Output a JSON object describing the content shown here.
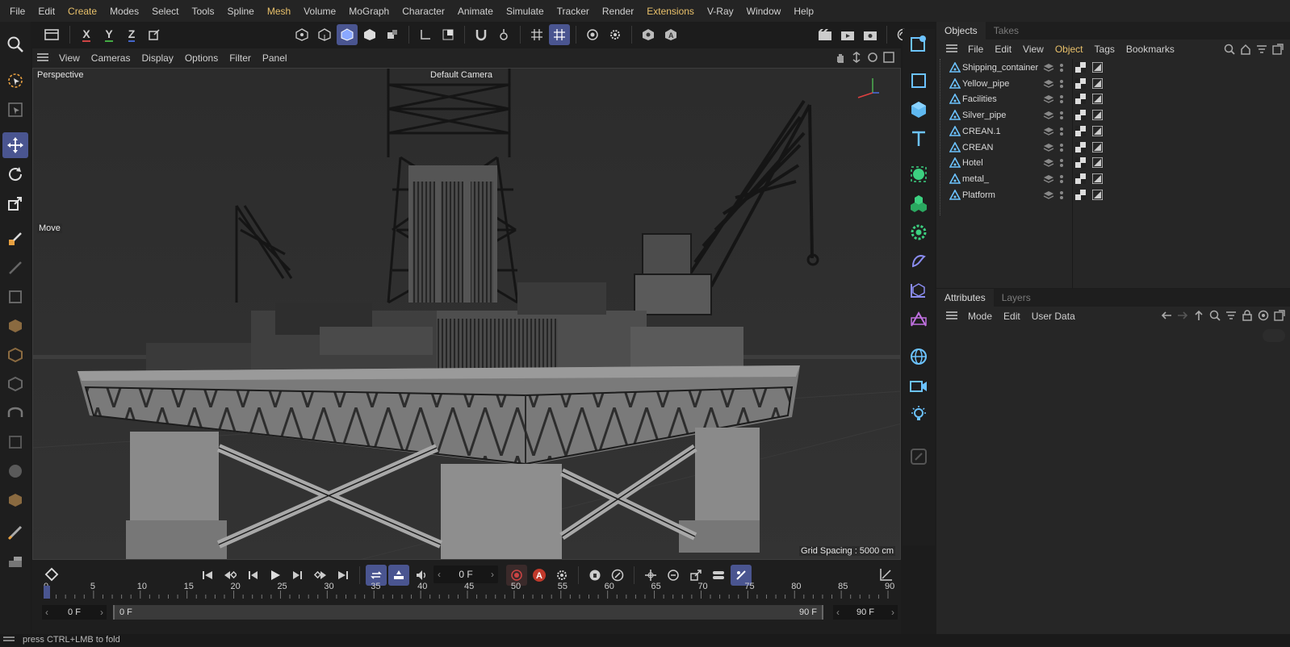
{
  "menu": [
    "File",
    "Edit",
    "Create",
    "Modes",
    "Select",
    "Tools",
    "Spline",
    "Mesh",
    "Volume",
    "MoGraph",
    "Character",
    "Animate",
    "Simulate",
    "Tracker",
    "Render",
    "Extensions",
    "V-Ray",
    "Window",
    "Help"
  ],
  "menu_highlight": [
    "Create",
    "Mesh",
    "Extensions"
  ],
  "axis_buttons": [
    "X",
    "Y",
    "Z"
  ],
  "viewport": {
    "menu": [
      "View",
      "Cameras",
      "Display",
      "Options",
      "Filter",
      "Panel"
    ],
    "label": "Perspective",
    "camera": "Default Camera",
    "tool_label": "Move",
    "grid_spacing": "Grid Spacing : 5000 cm"
  },
  "objects_panel": {
    "tabs": [
      "Objects",
      "Takes"
    ],
    "menu": [
      "File",
      "Edit",
      "View",
      "Object",
      "Tags",
      "Bookmarks"
    ],
    "items": [
      "Shipping_container",
      "Yellow_pipe",
      "Facilities",
      "Silver_pipe",
      "CREAN.1",
      "CREAN",
      "Hotel",
      "metal_",
      "Platform"
    ]
  },
  "attributes_panel": {
    "tabs": [
      "Attributes",
      "Layers"
    ],
    "menu": [
      "Mode",
      "Edit",
      "User Data"
    ]
  },
  "timeline": {
    "frame_field": "0 F",
    "ticks": [
      "0",
      "5",
      "10",
      "15",
      "20",
      "25",
      "30",
      "35",
      "40",
      "45",
      "50",
      "55",
      "60",
      "65",
      "70",
      "75",
      "80",
      "85",
      "90"
    ],
    "start_field": "0 F",
    "range_start": "0 F",
    "range_end": "90 F",
    "end_field": "90 F"
  },
  "status": "press CTRL+LMB to fold",
  "colors": {
    "accent": "#4a5590",
    "highlight": "#e8c06a",
    "object_icon": "#6cc3ff"
  }
}
